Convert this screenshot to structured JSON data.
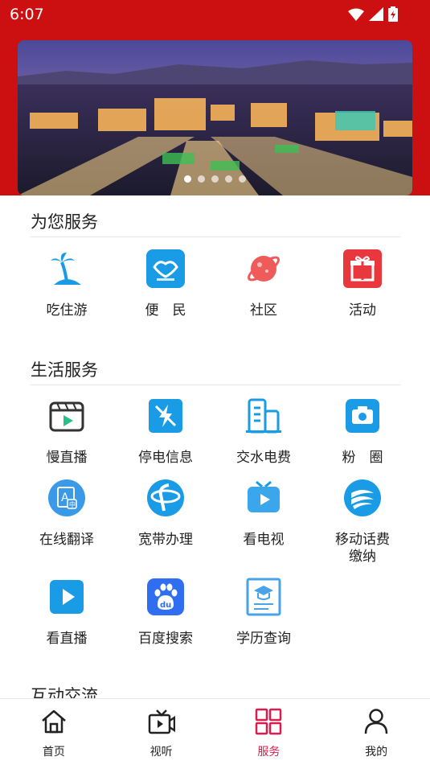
{
  "status": {
    "time": "6:07"
  },
  "banner": {
    "dots": 5,
    "active_dot": 0
  },
  "sections": [
    {
      "title": "为您服务",
      "items": [
        {
          "label": "吃住游",
          "icon": "palm-island-icon"
        },
        {
          "label": "便　民",
          "icon": "handshake-icon"
        },
        {
          "label": "社区",
          "icon": "planet-icon"
        },
        {
          "label": "活动",
          "icon": "gift-icon"
        }
      ]
    },
    {
      "title": "生活服务",
      "items": [
        {
          "label": "慢直播",
          "icon": "clapperboard-icon"
        },
        {
          "label": "停电信息",
          "icon": "no-electricity-icon"
        },
        {
          "label": "交水电费",
          "icon": "building-icon"
        },
        {
          "label": "粉　圈",
          "icon": "camera-icon"
        },
        {
          "label": "在线翻译",
          "icon": "translate-icon"
        },
        {
          "label": "宽带办理",
          "icon": "telecom-icon"
        },
        {
          "label": "看电视",
          "icon": "tv-icon"
        },
        {
          "label": "移动话费缴纳",
          "icon": "china-mobile-icon"
        },
        {
          "label": "看直播",
          "icon": "live-play-icon"
        },
        {
          "label": "百度搜索",
          "icon": "baidu-icon"
        },
        {
          "label": "学历查询",
          "icon": "education-certificate-icon"
        }
      ]
    },
    {
      "title": "互动交流"
    }
  ],
  "nav": [
    {
      "label": "首页",
      "icon": "home-icon"
    },
    {
      "label": "视听",
      "icon": "video-icon"
    },
    {
      "label": "服务",
      "icon": "grid-icon"
    },
    {
      "label": "我的",
      "icon": "user-icon"
    }
  ],
  "colors": {
    "brand_red": "#cc0f10",
    "nav_active": "#d81e4f",
    "icon_blue": "#1a9be6"
  }
}
